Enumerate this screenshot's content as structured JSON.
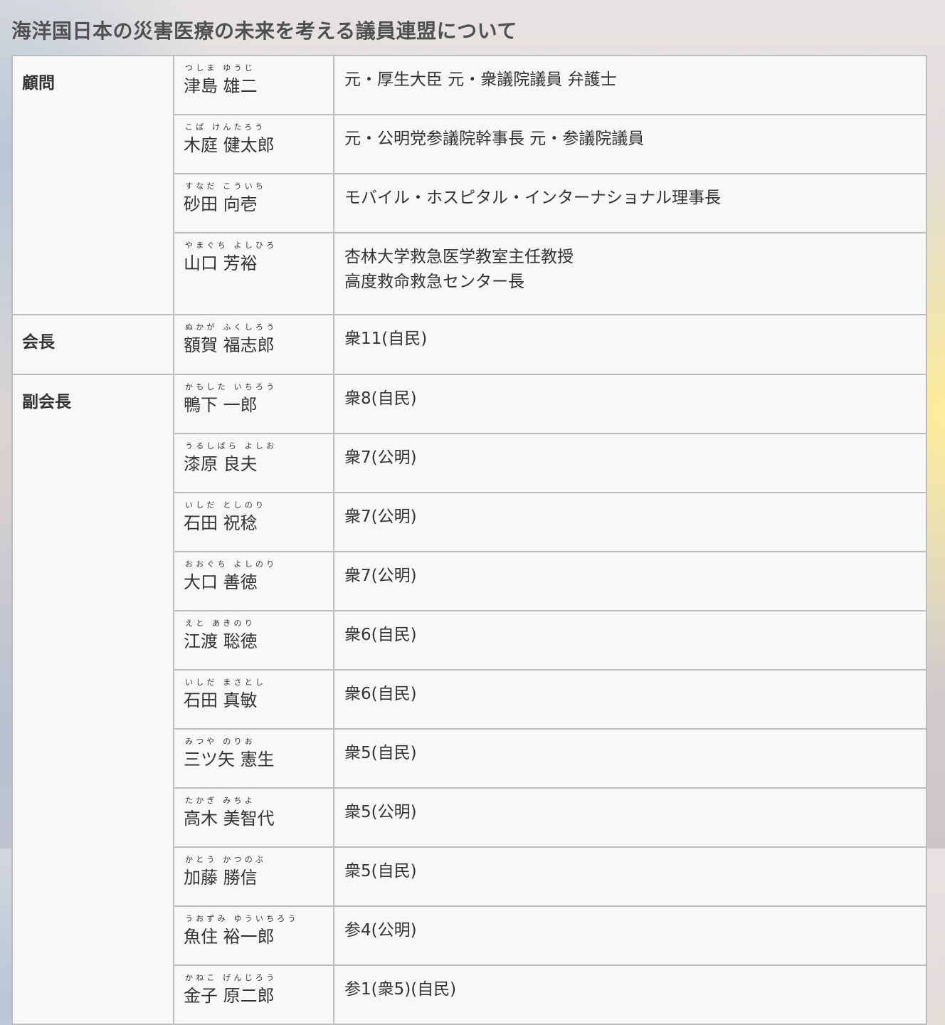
{
  "page_title": "海洋国日本の災害医療の未来を考える議員連盟について",
  "rows": [
    {
      "role": "顧問",
      "furigana": "つしま ゆうじ",
      "name": "津島 雄二",
      "desc": [
        "元・厚生大臣 元・衆議院議員 弁護士"
      ]
    },
    {
      "role": "",
      "furigana": "こば けんたろう",
      "name": "木庭 健太郎",
      "desc": [
        "元・公明党参議院幹事長 元・参議院議員"
      ]
    },
    {
      "role": "",
      "furigana": "すなだ こういち",
      "name": "砂田 向壱",
      "desc": [
        "モバイル・ホスピタル・インターナショナル理事長"
      ]
    },
    {
      "role": "",
      "furigana": "やまぐち よしひろ",
      "name": "山口 芳裕",
      "desc": [
        "杏林大学救急医学教室主任教授",
        "高度救命救急センター長"
      ]
    },
    {
      "role": "会長",
      "furigana": "ぬかが ふくしろう",
      "name": "額賀 福志郎",
      "desc": [
        "衆11(自民)"
      ]
    },
    {
      "role": "副会長",
      "furigana": "かもした いちろう",
      "name": "鴨下 一郎",
      "desc": [
        "衆8(自民)"
      ]
    },
    {
      "role": "",
      "furigana": "うるしばら よしお",
      "name": "漆原 良夫",
      "desc": [
        "衆7(公明)"
      ]
    },
    {
      "role": "",
      "furigana": "いしだ としのり",
      "name": "石田 祝稔",
      "desc": [
        "衆7(公明)"
      ]
    },
    {
      "role": "",
      "furigana": "おおぐち よしのり",
      "name": "大口 善徳",
      "desc": [
        "衆7(公明)"
      ]
    },
    {
      "role": "",
      "furigana": "えと あきのり",
      "name": "江渡 聡徳",
      "desc": [
        "衆6(自民)"
      ]
    },
    {
      "role": "",
      "furigana": "いしだ まさとし",
      "name": "石田 真敏",
      "desc": [
        "衆6(自民)"
      ]
    },
    {
      "role": "",
      "furigana": "みつや のりお",
      "name": "三ツ矢 憲生",
      "desc": [
        "衆5(自民)"
      ]
    },
    {
      "role": "",
      "furigana": "たかぎ みちよ",
      "name": "高木 美智代",
      "desc": [
        "衆5(公明)"
      ]
    },
    {
      "role": "",
      "furigana": "かとう かつのぶ",
      "name": "加藤 勝信",
      "desc": [
        "衆5(自民)"
      ]
    },
    {
      "role": "",
      "furigana": "うおずみ ゆういちろう",
      "name": "魚住 裕一郎",
      "desc": [
        "参4(公明)"
      ]
    },
    {
      "role": "",
      "furigana": "かねこ げんじろう",
      "name": "金子 原二郎",
      "desc": [
        "参1(衆5)(自民)"
      ]
    }
  ]
}
